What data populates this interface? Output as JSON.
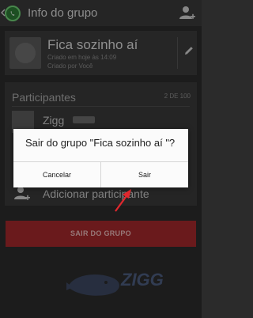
{
  "actionbar": {
    "title": "Info do grupo"
  },
  "group": {
    "name": "Fica sozinho aí",
    "created_line1": "Criado em hoje às 14:09",
    "created_line2": "Criado por Você"
  },
  "participants": {
    "title": "Participantes",
    "count": "2 DE 100",
    "items": [
      {
        "name": "Zigg"
      }
    ],
    "add_label": "Adicionar participante"
  },
  "leave_button": "SAIR DO GRUPO",
  "dialog": {
    "message": "Sair do grupo \"Fica sozinho aí \"?",
    "cancel": "Cancelar",
    "confirm": "Sair"
  },
  "watermark": {
    "text": "ZIGG"
  },
  "colors": {
    "accent_red": "#a3282b",
    "whatsapp_green": "#2d7a35",
    "annotation_arrow": "#e0282e"
  }
}
